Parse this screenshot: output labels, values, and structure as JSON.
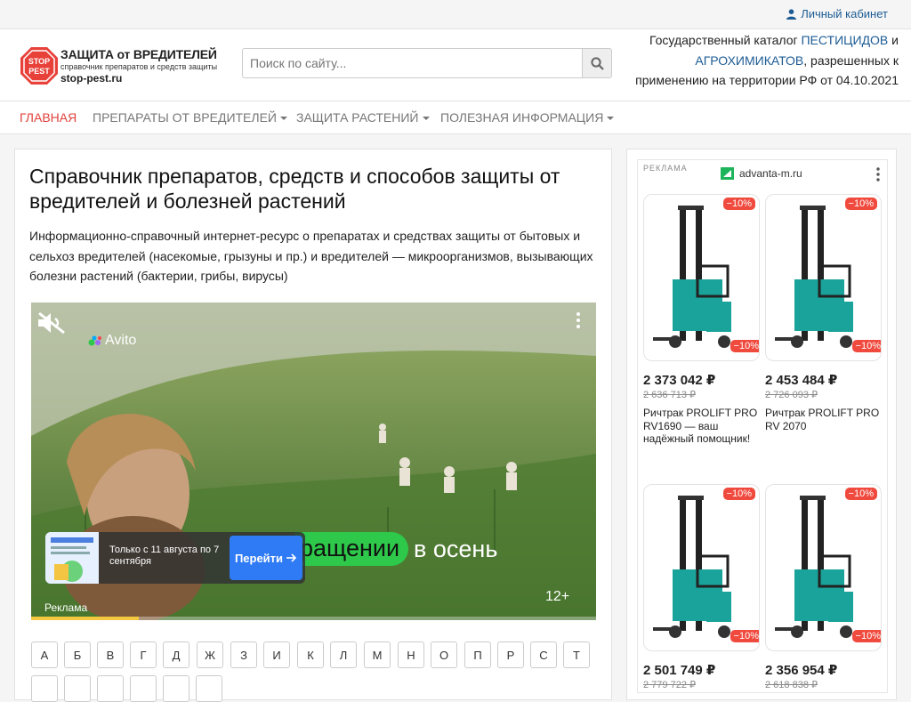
{
  "topbar": {
    "cabinet_label": "Личный кабинет"
  },
  "logo": {
    "badge_text": "STOP PEST",
    "title": "ЗАЩИТА от ВРЕДИТЕЛЕЙ",
    "subtitle": "справочник препаратов и средств защиты",
    "domain": "stop-pest.ru"
  },
  "search": {
    "placeholder": "Поиск по сайту..."
  },
  "catalog": {
    "prefix": "Государственный каталог",
    "link1": "ПЕСТИЦИДОВ",
    "conj": "и",
    "link2": "АГРОХИМИКАТОВ",
    "suffix": ", разрешенных к применению на территории РФ от 04.10.2021"
  },
  "nav": {
    "items": [
      {
        "label": "ГЛАВНАЯ"
      },
      {
        "label": "ПРЕПАРАТЫ ОТ ВРЕДИТЕЛЕЙ"
      },
      {
        "label": "ЗАЩИТА РАСТЕНИЙ"
      },
      {
        "label": "ПОЛЕЗНАЯ ИНФОРМАЦИЯ"
      }
    ]
  },
  "main": {
    "title": "Справочник препаратов, средств и способов защиты от вредителей и болезней растений",
    "intro": "Информационно-справочный интернет-ресурс о препаратах и средствах защиты от бытовых и сельхоз вредителей (насекомые, грызуны и пр.) и вредителей — микроорганизмов, вызывающих болезни растений (бактерии, грибы, вирусы)"
  },
  "video_ad": {
    "brand": "Avito",
    "headline_part1": "ращении",
    "headline_part2": "в осень",
    "age_rating": "12+",
    "ad_label": "Реклама",
    "promo_text": "Только с 11 августа по 7 сентября",
    "cta_label": "Перейти",
    "progress": 0.19
  },
  "letters": [
    "А",
    "Б",
    "В",
    "Г",
    "Д",
    "Ж",
    "З",
    "И",
    "К",
    "Л",
    "М",
    "Н",
    "О",
    "П",
    "Р",
    "С",
    "Т"
  ],
  "side_ad": {
    "label": "РЕКЛАМА",
    "domain": "advanta-m.ru",
    "products": [
      {
        "discount": "−10%",
        "price": "2 373 042 ₽",
        "old_price": "2 636 713 ₽",
        "name": "Ричтрак PROLIFT PRO RV1690 — ваш надёжный помощник!"
      },
      {
        "discount": "−10%",
        "price": "2 453 484 ₽",
        "old_price": "2 726 093 ₽",
        "name": "Ричтрак PROLIFT PRO RV 2070"
      },
      {
        "discount": "−10%",
        "price": "2 501 749 ₽",
        "old_price": "2 779 722 ₽",
        "name": ""
      },
      {
        "discount": "−10%",
        "price": "2 356 954 ₽",
        "old_price": "2 618 838 ₽",
        "name": ""
      }
    ]
  },
  "colors": {
    "accent": "#e0413b",
    "link": "#1d5c94",
    "badge": "#f04a3e",
    "cta": "#2f7bf5",
    "avito_green": "#2ec94a"
  }
}
